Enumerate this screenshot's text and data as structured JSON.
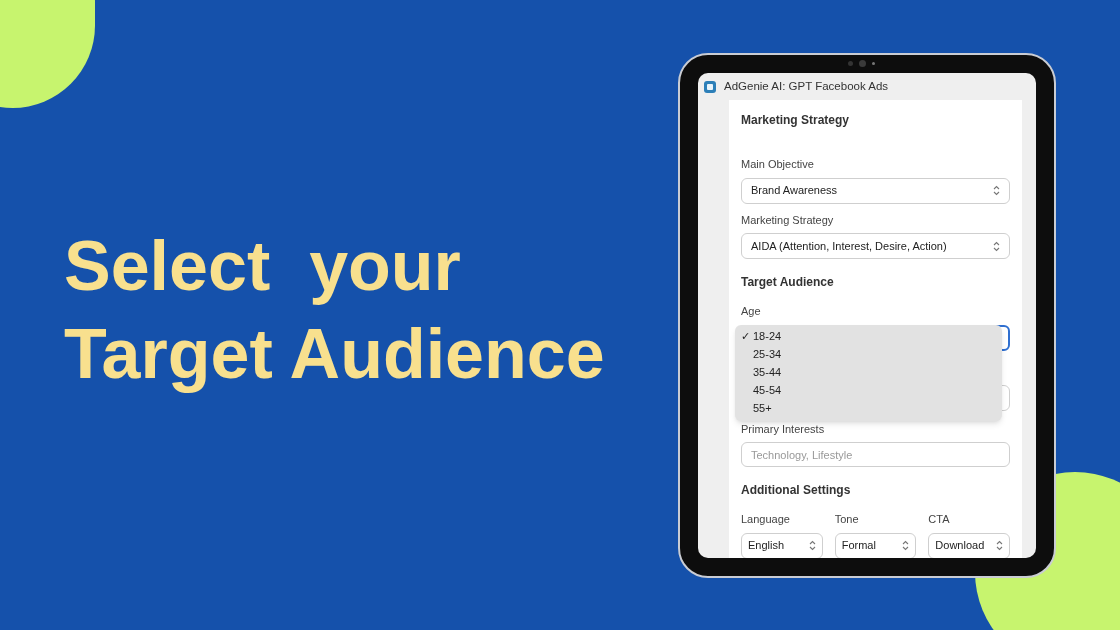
{
  "headline": [
    "Select  your",
    "Target Audience"
  ],
  "app": {
    "title": "AdGenie AI: GPT Facebook Ads",
    "sections": [
      {
        "heading": "Marketing Strategy",
        "fields": [
          {
            "kind": "select",
            "label": "Main Objective",
            "value": "Brand Awareness"
          },
          {
            "kind": "select",
            "label": "Marketing Strategy",
            "value": "AIDA (Attention, Interest, Desire, Action)"
          }
        ]
      },
      {
        "heading": "Target Audience",
        "fields": [
          {
            "kind": "select",
            "label": "Age",
            "focused": true,
            "check_mark": "✓",
            "options": [
              {
                "label": "18-24",
                "selected": true
              },
              {
                "label": "25-34",
                "selected": false
              },
              {
                "label": "35-44",
                "selected": false
              },
              {
                "label": "45-54",
                "selected": false
              },
              {
                "label": "55+",
                "selected": false
              }
            ]
          },
          {
            "kind": "select"
          },
          {
            "kind": "input",
            "label": "Primary Interests",
            "placeholder": "Technology, Lifestyle"
          }
        ]
      },
      {
        "heading": "Additional Settings",
        "row": true,
        "fields": [
          {
            "kind": "select",
            "label": "Language",
            "value": "English"
          },
          {
            "kind": "select",
            "label": "Tone",
            "value": "Formal"
          },
          {
            "kind": "select",
            "label": "CTA",
            "value": "Download"
          }
        ]
      }
    ]
  }
}
